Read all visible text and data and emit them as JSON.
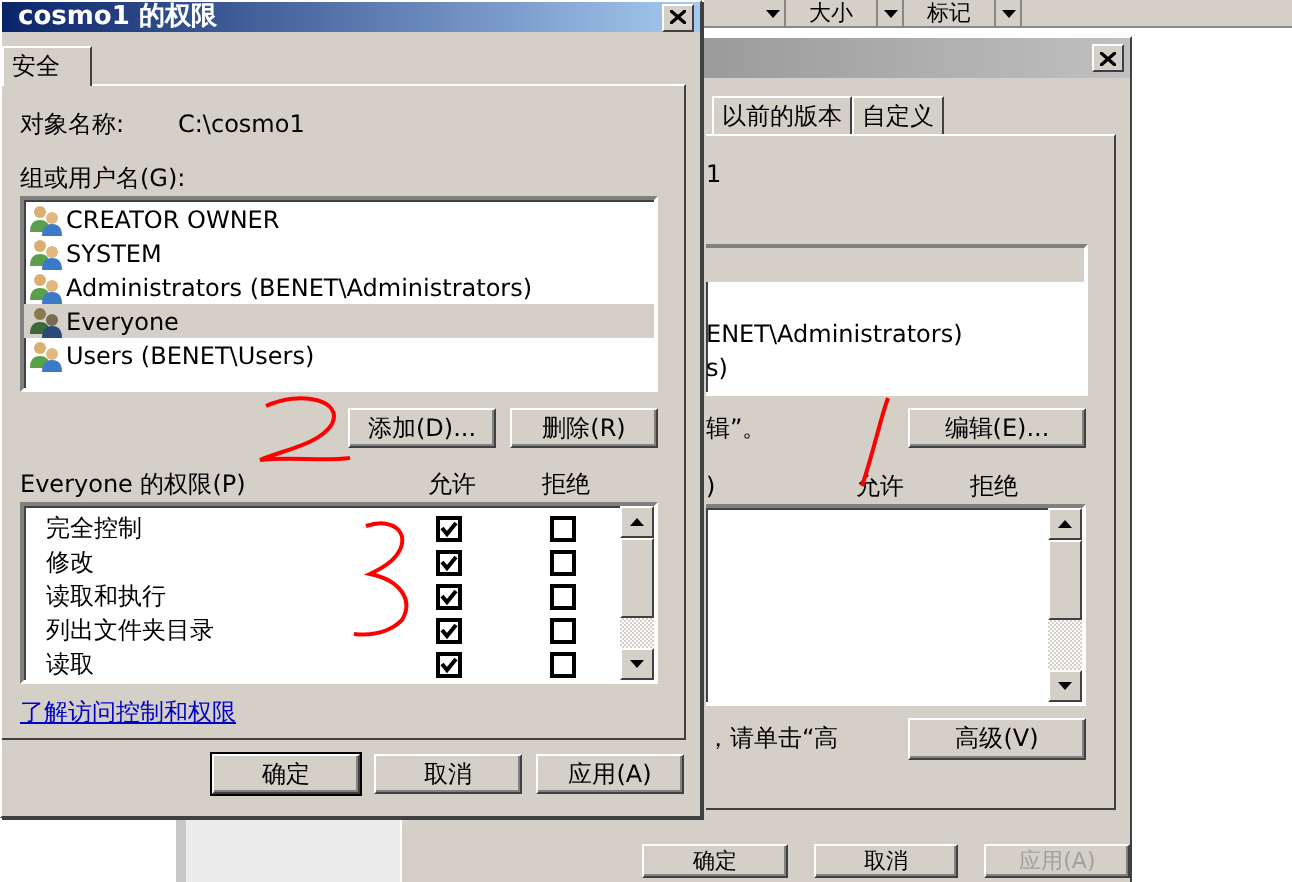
{
  "background": {
    "column_headers": [
      {
        "label": "大小"
      },
      {
        "label": "标记"
      }
    ]
  },
  "back_window": {
    "tabs": [
      {
        "label": "以前的版本",
        "selected": false
      },
      {
        "label": "自定义",
        "selected": false
      }
    ],
    "object_name_fragment": "1",
    "users": [
      {
        "selected": true
      },
      {
        "selected": false
      },
      {
        "label": "ENET\\Administrators)",
        "selected": false
      },
      {
        "label": "s)",
        "selected": false
      }
    ],
    "edit_hint": "辑”。",
    "edit_button": "编辑(E)...",
    "permissions_label": ")",
    "permission_columns": [
      "允许",
      "拒绝"
    ],
    "advanced_hint": "，请单击“高",
    "advanced_button": "高级(V)",
    "buttons": [
      {
        "label": "确定",
        "disabled": false
      },
      {
        "label": "取消",
        "disabled": false
      },
      {
        "label": "应用(A)",
        "disabled": true
      }
    ]
  },
  "dialog": {
    "title": "cosmo1 的权限",
    "tabs": [
      {
        "label": "安全",
        "selected": true
      }
    ],
    "object_name_label": "对象名称:",
    "object_name": "C:\\cosmo1",
    "users_label": "组或用户名(G):",
    "users": [
      {
        "name": "CREATOR OWNER",
        "selected": false
      },
      {
        "name": "SYSTEM",
        "selected": false
      },
      {
        "name": "Administrators (BENET\\Administrators)",
        "selected": false
      },
      {
        "name": "Everyone",
        "selected": true
      },
      {
        "name": "Users (BENET\\Users)",
        "selected": false
      }
    ],
    "user_buttons": [
      "添加(D)...",
      "删除(R)"
    ],
    "permissions_label": "Everyone 的权限(P)",
    "permission_columns": [
      "允许",
      "拒绝"
    ],
    "permissions": [
      {
        "name": "完全控制",
        "allow": true,
        "deny": false
      },
      {
        "name": "修改",
        "allow": true,
        "deny": false
      },
      {
        "name": "读取和执行",
        "allow": true,
        "deny": false
      },
      {
        "name": "列出文件夹目录",
        "allow": true,
        "deny": false
      },
      {
        "name": "读取",
        "allow": true,
        "deny": false
      }
    ],
    "link": "了解访问控制和权限",
    "buttons": [
      {
        "label": "确定",
        "default": true
      },
      {
        "label": "取消",
        "default": false
      },
      {
        "label": "应用(A)",
        "default": false
      }
    ]
  }
}
